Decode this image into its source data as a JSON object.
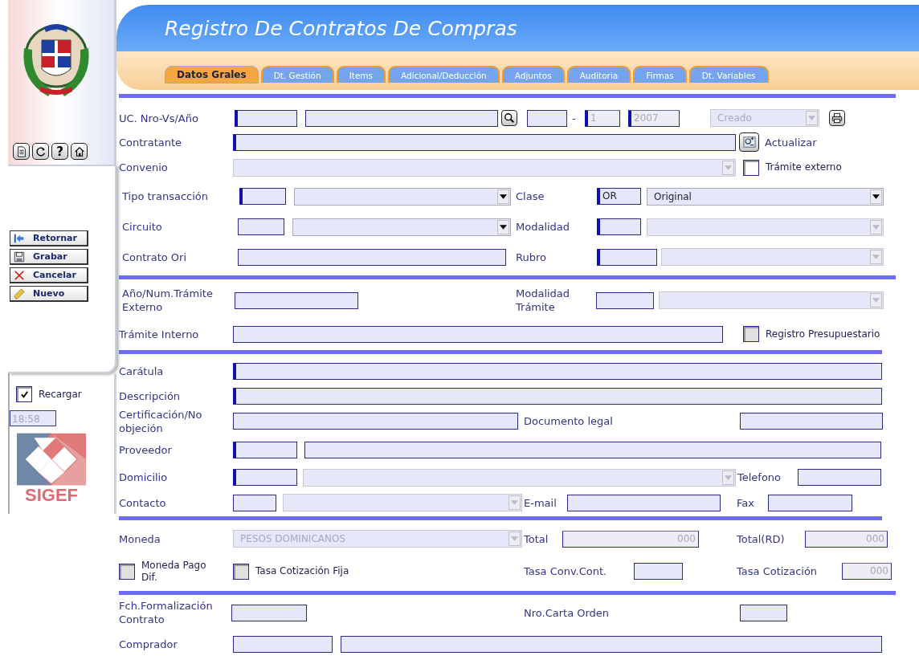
{
  "title": "Registro De Contratos De Compras",
  "tabs": [
    {
      "label": "Datos Grales",
      "selected": true
    },
    {
      "label": "Dt. Gestión",
      "selected": false
    },
    {
      "label": "Items",
      "selected": false
    },
    {
      "label": "Adicional/Deducción",
      "selected": false
    },
    {
      "label": "Adjuntos",
      "selected": false
    },
    {
      "label": "Auditoria",
      "selected": false
    },
    {
      "label": "Firmas",
      "selected": false
    },
    {
      "label": "Dt. Variables",
      "selected": false
    }
  ],
  "sidebar": {
    "help_button": "?",
    "nav_buttons": [
      {
        "kind": "back",
        "label": "Retornar"
      },
      {
        "kind": "save",
        "label": "Grabar"
      },
      {
        "kind": "cancel",
        "label": "Cancelar"
      },
      {
        "kind": "new",
        "label": "Nuevo"
      }
    ],
    "reload": {
      "label": "Recargar",
      "checked": true
    },
    "time": "18:58",
    "logo_text": "SIGEF"
  },
  "sections": [
    {
      "rows": [
        {
          "items": [
            {
              "kind": "label",
              "text": "UC. Nro-Vs/Año"
            },
            {
              "kind": "input",
              "required": true,
              "disabled": false
            },
            {
              "kind": "input",
              "required": false,
              "disabled": false
            },
            {
              "kind": "search"
            },
            {
              "kind": "input",
              "required": false,
              "disabled": false
            },
            {
              "kind": "text",
              "text": "-"
            },
            {
              "kind": "input",
              "value": "1",
              "required": true,
              "disabled": true
            },
            {
              "kind": "input",
              "value": "2007",
              "required": true,
              "disabled": true
            },
            {
              "kind": "select",
              "value": "Creado",
              "disabled": true
            },
            {
              "kind": "print"
            }
          ]
        },
        {
          "items": [
            {
              "kind": "label",
              "text": "Contratante"
            },
            {
              "kind": "input",
              "required": true,
              "disabled": false
            },
            {
              "kind": "update"
            },
            {
              "kind": "text",
              "text": "Actualizar"
            }
          ]
        },
        {
          "items": [
            {
              "kind": "label",
              "text": "Convenio"
            },
            {
              "kind": "select",
              "disabled": true
            },
            {
              "kind": "checkbox",
              "checked": false,
              "disabled": false
            },
            {
              "kind": "small",
              "text": "Trámite externo"
            }
          ]
        },
        {
          "items": [
            {
              "kind": "label",
              "text": "Tipo transacción"
            },
            {
              "kind": "input",
              "required": true,
              "disabled": false
            },
            {
              "kind": "select",
              "disabled": false
            },
            {
              "kind": "label",
              "text": "Clase"
            },
            {
              "kind": "input",
              "value": "OR",
              "required": true,
              "disabled": false
            },
            {
              "kind": "select",
              "value": "Original",
              "disabled": false
            }
          ]
        },
        {
          "items": [
            {
              "kind": "label",
              "text": "Circuito"
            },
            {
              "kind": "input",
              "required": false,
              "disabled": false
            },
            {
              "kind": "select",
              "disabled": false
            },
            {
              "kind": "label",
              "text": "Modalidad"
            },
            {
              "kind": "input",
              "required": true,
              "disabled": false
            },
            {
              "kind": "select",
              "disabled": true
            }
          ]
        },
        {
          "items": [
            {
              "kind": "label",
              "text": "Contrato Ori"
            },
            {
              "kind": "input",
              "required": false,
              "disabled": false
            },
            {
              "kind": "label",
              "text": "Rubro"
            },
            {
              "kind": "input",
              "required": true,
              "disabled": false
            },
            {
              "kind": "select",
              "disabled": true
            }
          ]
        }
      ]
    },
    {
      "rows": [
        {
          "items": [
            {
              "kind": "label",
              "text": "Año/Num.Trámite Externo"
            },
            {
              "kind": "input",
              "required": false,
              "disabled": false
            },
            {
              "kind": "label",
              "text": "Modalidad Trámite"
            },
            {
              "kind": "input",
              "required": false,
              "disabled": false
            },
            {
              "kind": "select",
              "disabled": true
            }
          ]
        },
        {
          "items": [
            {
              "kind": "label",
              "text": "Trámite Interno"
            },
            {
              "kind": "input",
              "required": false,
              "disabled": false
            },
            {
              "kind": "checkbox",
              "checked": false,
              "disabled": true
            },
            {
              "kind": "small",
              "text": "Registro Presupuestario"
            }
          ]
        }
      ]
    },
    {
      "rows": [
        {
          "items": [
            {
              "kind": "label",
              "text": "Carátula"
            },
            {
              "kind": "input",
              "required": true,
              "disabled": false
            }
          ]
        },
        {
          "items": [
            {
              "kind": "label",
              "text": "Descripción"
            },
            {
              "kind": "input",
              "required": true,
              "disabled": false
            }
          ]
        },
        {
          "items": [
            {
              "kind": "label",
              "text": "Certificación/No objeción"
            },
            {
              "kind": "input",
              "required": false,
              "disabled": false
            },
            {
              "kind": "label",
              "text": "Documento legal"
            },
            {
              "kind": "input",
              "required": false,
              "disabled": false
            }
          ]
        },
        {
          "items": [
            {
              "kind": "label",
              "text": "Proveedor"
            },
            {
              "kind": "input",
              "required": true,
              "disabled": false
            },
            {
              "kind": "input",
              "required": false,
              "disabled": false
            }
          ]
        },
        {
          "items": [
            {
              "kind": "label",
              "text": "Domicilio"
            },
            {
              "kind": "input",
              "required": true,
              "disabled": false
            },
            {
              "kind": "select",
              "disabled": true
            },
            {
              "kind": "label",
              "text": "Telefono"
            },
            {
              "kind": "input",
              "required": false,
              "disabled": false
            }
          ]
        },
        {
          "items": [
            {
              "kind": "label",
              "text": "Contacto"
            },
            {
              "kind": "input",
              "required": false,
              "disabled": false
            },
            {
              "kind": "select",
              "disabled": true
            },
            {
              "kind": "label",
              "text": "E-mail"
            },
            {
              "kind": "input",
              "required": false,
              "disabled": false
            },
            {
              "kind": "label",
              "text": "Fax"
            },
            {
              "kind": "input",
              "required": false,
              "disabled": false
            }
          ]
        }
      ]
    },
    {
      "rows": [
        {
          "items": [
            {
              "kind": "label",
              "text": "Moneda"
            },
            {
              "kind": "select",
              "value": "PESOS DOMINICANOS",
              "disabled": true
            },
            {
              "kind": "label",
              "text": "Total"
            },
            {
              "kind": "input",
              "value": "000",
              "required": false,
              "disabled": true
            },
            {
              "kind": "label",
              "text": "Total(RD)"
            },
            {
              "kind": "input",
              "value": "000",
              "required": false,
              "disabled": true
            }
          ]
        },
        {
          "items": [
            {
              "kind": "checkbox",
              "checked": false,
              "disabled": true
            },
            {
              "kind": "small",
              "text": "Moneda Pago Dif."
            },
            {
              "kind": "checkbox",
              "checked": false,
              "disabled": true
            },
            {
              "kind": "small",
              "text": "Tasa Cotización Fija"
            },
            {
              "kind": "label",
              "text": "Tasa Conv.Cont."
            },
            {
              "kind": "input",
              "required": false,
              "disabled": false
            },
            {
              "kind": "label",
              "text": "Tasa Cotización"
            },
            {
              "kind": "input",
              "value": "000",
              "required": false,
              "disabled": true
            }
          ]
        }
      ]
    },
    {
      "rows": [
        {
          "items": [
            {
              "kind": "label",
              "text": "Fch.Formalización Contrato"
            },
            {
              "kind": "input",
              "required": false,
              "disabled": false
            },
            {
              "kind": "label",
              "text": "Nro.Carta Orden"
            },
            {
              "kind": "input",
              "required": false,
              "disabled": false
            }
          ]
        },
        {
          "items": [
            {
              "kind": "label",
              "text": "Comprador"
            },
            {
              "kind": "input",
              "required": false,
              "disabled": false
            },
            {
              "kind": "input",
              "required": false,
              "disabled": false
            }
          ]
        }
      ]
    }
  ]
}
